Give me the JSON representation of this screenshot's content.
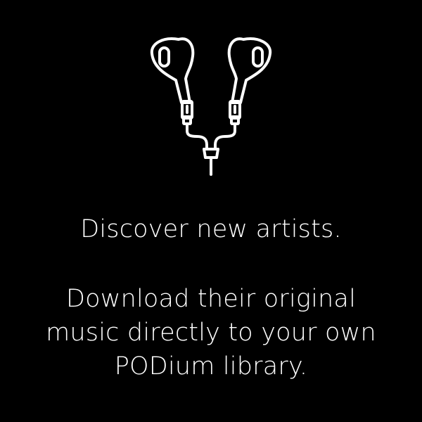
{
  "screen": {
    "background_color": "#000000",
    "foreground_color": "#ffffff"
  },
  "illustration": {
    "icon": "earbuds-icon"
  },
  "onboarding": {
    "headline": "Discover new artists.",
    "description_lines": [
      "Download their original",
      "music directly to your own",
      "PODium library."
    ]
  }
}
